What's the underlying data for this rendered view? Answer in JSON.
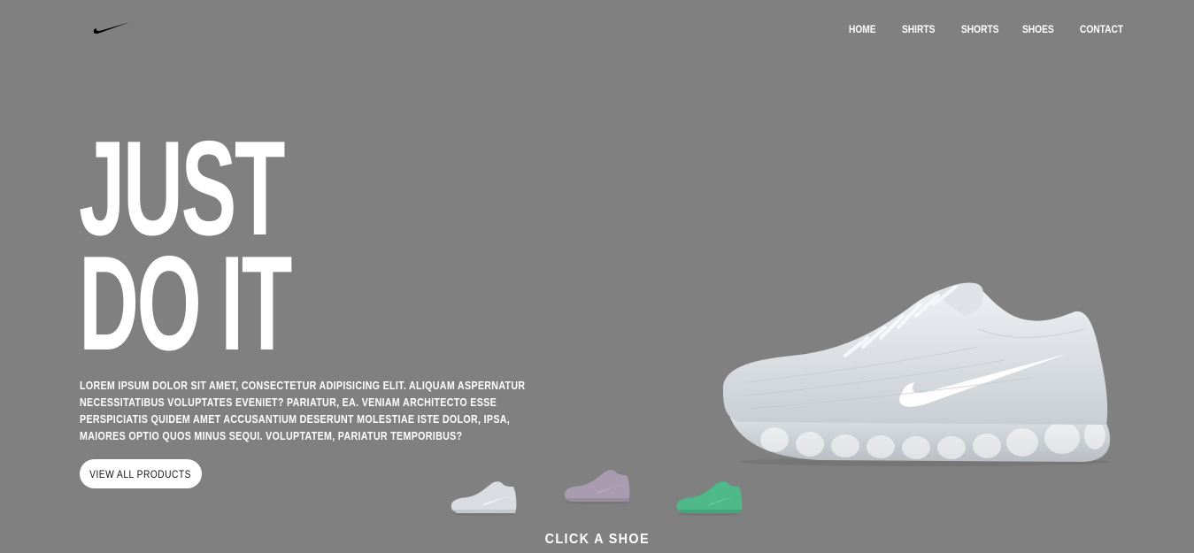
{
  "brand": {
    "logo_icon": "swoosh-icon"
  },
  "nav": {
    "items": [
      {
        "label": "HOME"
      },
      {
        "label": "SHIRTS"
      },
      {
        "label": "SHORTS"
      },
      {
        "label": "SHOES"
      },
      {
        "label": "CONTACT"
      }
    ]
  },
  "hero": {
    "headline_line1": "JUST",
    "headline_line2": "DO IT",
    "description": "LOREM IPSUM DOLOR SIT AMET, CONSECTETUR ADIPISICING ELIT. ALIQUAM ASPERNATUR NECESSITATIBUS VOLUPTATES EVENIET? PARIATUR, EA. VENIAM ARCHITECTO ESSE PERSPICIATIS QUIDEM AMET ACCUSANTIUM DESERUNT MOLESTIAE ISTE DOLOR, IPSA, MAIORES OPTIO QUOS MINUS SEQUI. VOLUPTATEM, PARIATUR TEMPORIBUS?",
    "cta_label": "VIEW ALL PRODUCTS"
  },
  "shoes": {
    "selected_color": "#d9dde2",
    "thumbnails": [
      {
        "color": "#d9dde2"
      },
      {
        "color": "#a99bb0"
      },
      {
        "color": "#4fb98a"
      }
    ],
    "prompt": "CLICK A SHOE"
  },
  "colors": {
    "background": "#808080",
    "text": "#ffffff",
    "button_bg": "#ffffff"
  }
}
